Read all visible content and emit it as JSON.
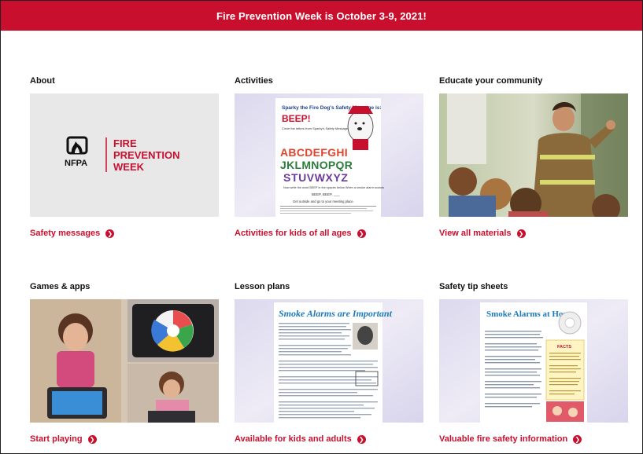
{
  "banner": {
    "text": "Fire Prevention Week is October 3-9, 2021!"
  },
  "cards": [
    {
      "heading": "About",
      "link": "Safety messages",
      "image": {
        "logo_org": "NFPA",
        "logo_lines": [
          "FIRE",
          "PREVENTION",
          "WEEK"
        ]
      }
    },
    {
      "heading": "Activities",
      "link": "Activities for kids of all ages",
      "image": {
        "title": "Sparky the Fire Dog's Safety Message is:",
        "highlight": "BEEP!",
        "instruction": "Circle the letters from Sparky's Safety Message word.",
        "letters": [
          "ABCDEFGHI",
          "JKLMNOPQR",
          "STUVWXYZ"
        ],
        "caption": "Now write the word BEEP in the spaces below When a smoke alarm sounds",
        "beep_line": "BEEP, BEEP, ___",
        "footer": "Get outside and go to your meeting place."
      }
    },
    {
      "heading": "Educate your community",
      "link": "View all materials",
      "image": {}
    },
    {
      "heading": "Games & apps",
      "link": "Start playing",
      "image": {}
    },
    {
      "heading": "Lesson plans",
      "link": "Available for kids and adults",
      "image": {
        "title": "Smoke Alarms are Important"
      }
    },
    {
      "heading": "Safety tip sheets",
      "link": "Valuable fire safety information",
      "image": {
        "title": "Smoke Alarms at Home",
        "facts": "FACTS"
      }
    }
  ],
  "colors": {
    "brand_red": "#c8102e",
    "lavender": "#e6e3f1"
  },
  "icons": {
    "link_arrow": "chevron-right-circle-icon"
  }
}
